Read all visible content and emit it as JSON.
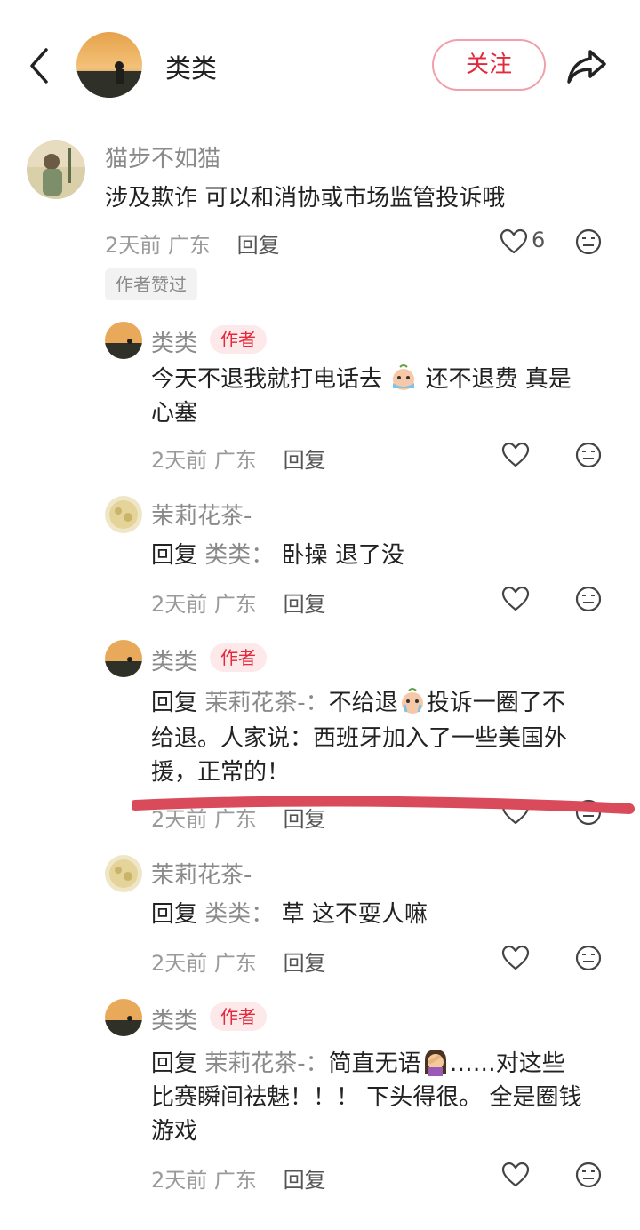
{
  "header": {
    "title": "类类",
    "follow_label": "关注"
  },
  "comments": [
    {
      "name": "猫步不如猫",
      "text": "涉及欺诈 可以和消协或市场监管投诉哦",
      "time": "2天前",
      "location": "广东",
      "reply_label": "回复",
      "like_count": "6",
      "badge": "作者赞过"
    },
    {
      "name": "类类",
      "tag": "作者",
      "text_a": "今天不退我就打电话去",
      "text_b": "还不退费 真是",
      "text_c": "心塞",
      "emoji": "crying-emoji",
      "time": "2天前",
      "location": "广东",
      "reply_label": "回复"
    },
    {
      "name": "茉莉花茶-",
      "reply_prefix": "回复",
      "reply_to": "类类：",
      "text": "卧操 退了没",
      "time": "2天前",
      "location": "广东",
      "reply_label": "回复"
    },
    {
      "name": "类类",
      "tag": "作者",
      "reply_prefix": "回复",
      "reply_to": "茉莉花茶-：",
      "text_a": "不给退",
      "text_b": "投诉一圈了不",
      "text_c": "给退。人家说：西班牙加入了一些美国外",
      "text_d": "援，正常的！",
      "emoji": "crying-emoji",
      "time": "2天前",
      "location": "广东",
      "reply_label": "回复"
    },
    {
      "name": "茉莉花茶-",
      "reply_prefix": "回复",
      "reply_to": "类类：",
      "text": "草 这不耍人嘛",
      "time": "2天前",
      "location": "广东",
      "reply_label": "回复"
    },
    {
      "name": "类类",
      "tag": "作者",
      "reply_prefix": "回复",
      "reply_to": "茉莉花茶-：",
      "text_a": "简直无语",
      "text_b": "……对这些",
      "text_c": "比赛瞬间祛魅！！！ 下头得很。 全是圈钱",
      "text_d": "游戏",
      "emoji": "facepalm-emoji",
      "time": "2天前",
      "location": "广东",
      "reply_label": "回复"
    }
  ],
  "colors": {
    "accent": "#e3293b",
    "underline_mark": "#d94a5a"
  }
}
